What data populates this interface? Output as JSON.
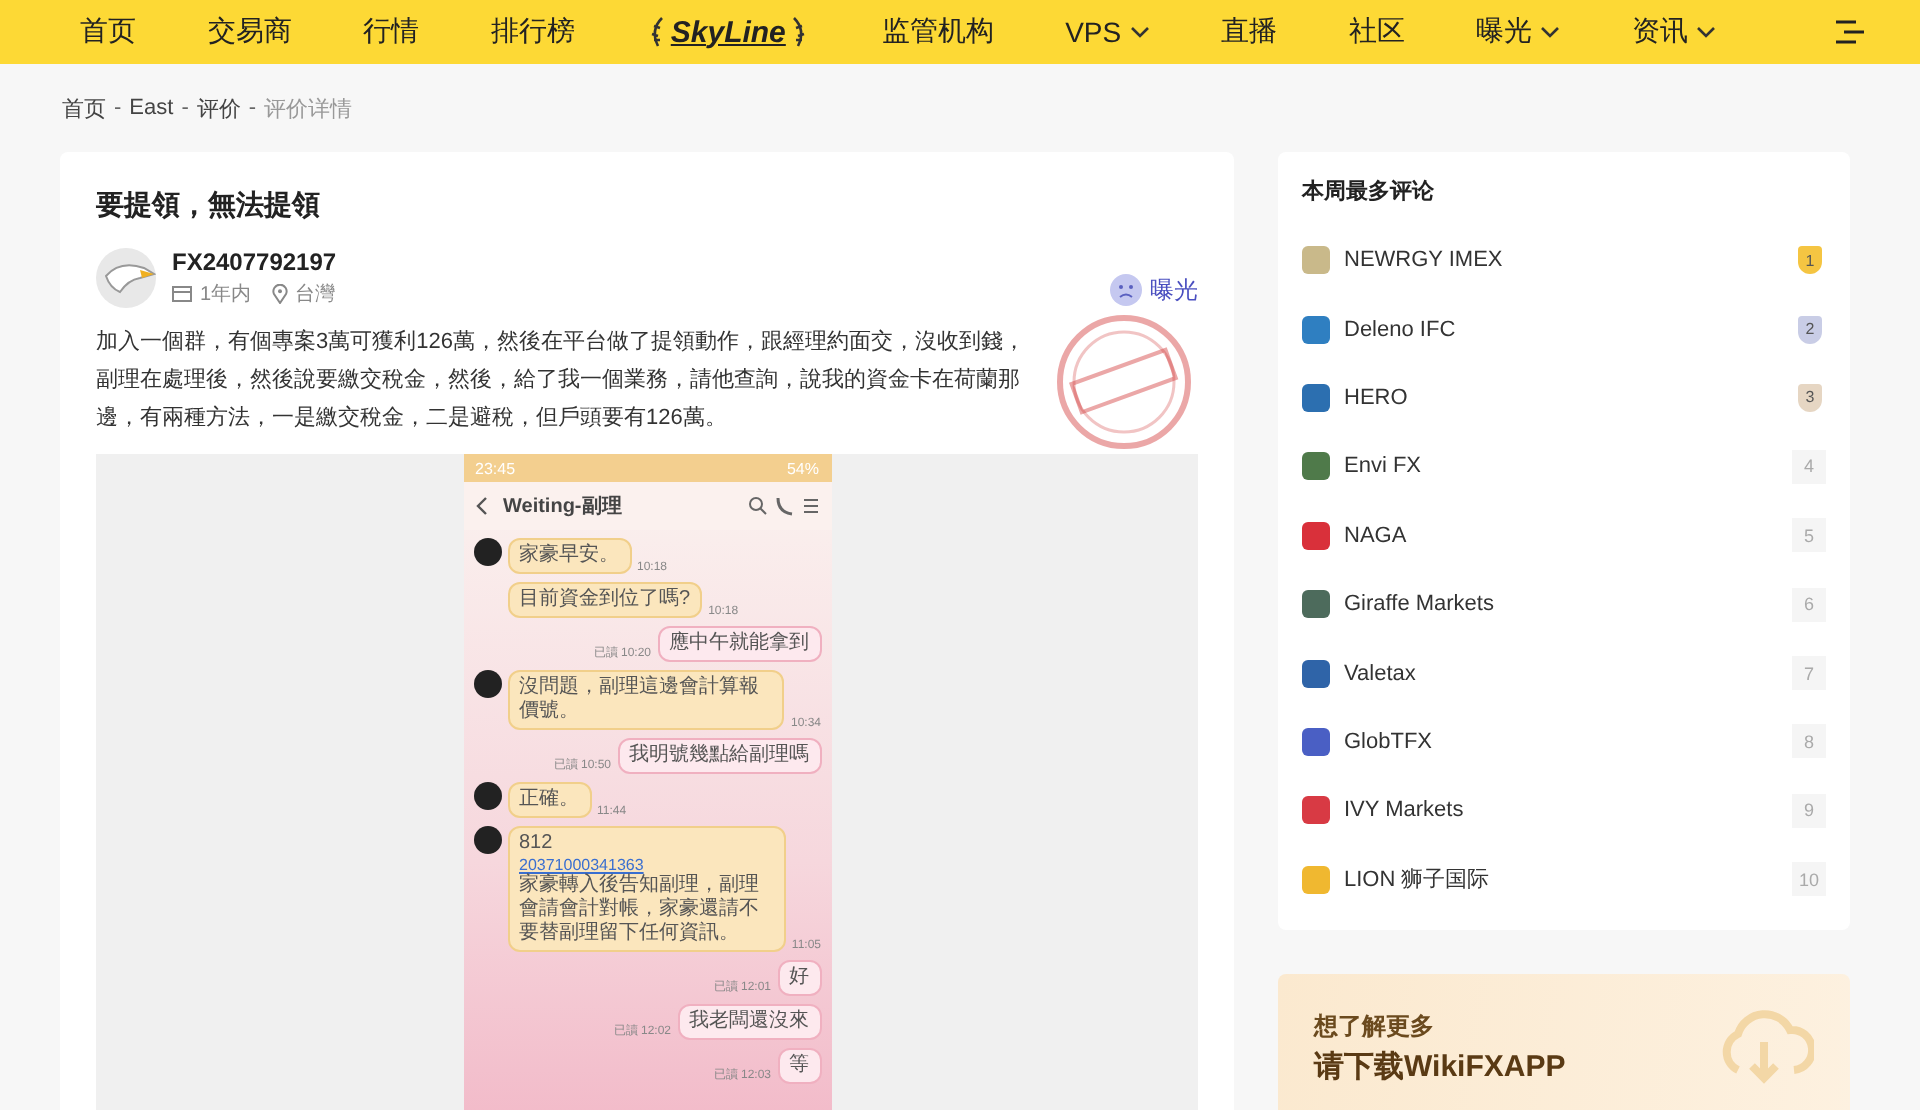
{
  "nav": {
    "items": [
      {
        "label": "首页",
        "kind": "link",
        "dropdown": false
      },
      {
        "label": "交易商",
        "kind": "link",
        "dropdown": false
      },
      {
        "label": "行情",
        "kind": "link",
        "dropdown": false
      },
      {
        "label": "排行榜",
        "kind": "link",
        "dropdown": false
      },
      {
        "label": "SkyLine",
        "kind": "logo"
      },
      {
        "label": "监管机构",
        "kind": "link",
        "dropdown": false
      },
      {
        "label": "VPS",
        "kind": "link",
        "dropdown": true
      },
      {
        "label": "直播",
        "kind": "link",
        "dropdown": false
      },
      {
        "label": "社区",
        "kind": "link",
        "dropdown": false
      },
      {
        "label": "曝光",
        "kind": "link",
        "dropdown": true
      },
      {
        "label": "资讯",
        "kind": "link",
        "dropdown": true
      }
    ]
  },
  "breadcrumb": [
    {
      "label": "首页",
      "current": false
    },
    {
      "sep": "-",
      "label": "East",
      "current": false
    },
    {
      "sep": "-",
      "label": "评价",
      "current": false
    },
    {
      "sep": "-",
      "label": "评价详情",
      "current": true
    }
  ],
  "post": {
    "title": "要提領，無法提領",
    "author": "FX2407792197",
    "time": "1年内",
    "location": "台灣",
    "tag": "曝光",
    "body": "加入一個群，有個專案3萬可獲利126萬，然後在平台做了提領動作，跟經理約面交，沒收到錢，副理在處理後，然後說要繳交稅金，然後，給了我一個業務，請他查詢，說我的資金卡在荷蘭那邊，有兩種方法，一是繳交稅金，二是避稅，但戶頭要有126萬。",
    "chat": {
      "clock": "23:45",
      "battery": "54%",
      "contact": "Weiting-副理",
      "messages": [
        {
          "kind": "incoming",
          "avatar": true,
          "text": "家豪早安。",
          "time": "10:18"
        },
        {
          "kind": "incoming",
          "avatar": false,
          "text": "目前資金到位了嗎?",
          "time": "10:18"
        },
        {
          "kind": "outgoing",
          "text": "應中午就能拿到",
          "read": "已讀",
          "time": "10:20"
        },
        {
          "kind": "incoming",
          "avatar": true,
          "text": "沒問題，副理這邊會計算報價號。",
          "time": "10:34"
        },
        {
          "kind": "outgoing",
          "text": "我明號幾點給副理嗎",
          "read": "已讀",
          "time": "10:50"
        },
        {
          "kind": "incoming",
          "avatar": true,
          "text": "正確。",
          "time": "11:44"
        },
        {
          "kind": "incoming",
          "avatar": true,
          "text": "812",
          "link": "20371000341363",
          "extra": "家豪轉入後告知副理，副理會請會計對帳，家豪還請不要替副理留下任何資訊。",
          "time": "11:05"
        },
        {
          "kind": "outgoing",
          "text": "好",
          "read": "已讀",
          "time": "12:01"
        },
        {
          "kind": "outgoing",
          "text": "我老闆還沒來",
          "read": "已讀",
          "time": "12:02"
        },
        {
          "kind": "outgoing",
          "text": "等",
          "read": "已讀",
          "time": "12:03"
        }
      ]
    }
  },
  "sidebar": {
    "title": "本周最多评论",
    "items": [
      {
        "name": "NEWRGY IMEX",
        "rank": "1",
        "kind": "gold",
        "color": "#c9b98a"
      },
      {
        "name": "Deleno IFC",
        "rank": "2",
        "kind": "silver",
        "color": "#2f7fc1"
      },
      {
        "name": "HERO",
        "rank": "3",
        "kind": "bronze",
        "color": "#2c6fb0"
      },
      {
        "name": "Envi FX",
        "rank": "4",
        "kind": "plain",
        "color": "#4f7a4a"
      },
      {
        "name": "NAGA",
        "rank": "5",
        "kind": "plain",
        "color": "#d9303a"
      },
      {
        "name": "Giraffe Markets",
        "rank": "6",
        "kind": "plain",
        "color": "#4d6b5c"
      },
      {
        "name": "Valetax",
        "rank": "7",
        "kind": "plain",
        "color": "#2f64a8"
      },
      {
        "name": "GlobTFX",
        "rank": "8",
        "kind": "plain",
        "color": "#4a5fc4"
      },
      {
        "name": "IVY Markets",
        "rank": "9",
        "kind": "plain",
        "color": "#d83a44"
      },
      {
        "name": "LION 狮子国际",
        "rank": "10",
        "kind": "plain",
        "color": "#f0b830"
      }
    ]
  },
  "promo": {
    "line1": "想了解更多",
    "line2": "请下载WikiFXAPP"
  }
}
